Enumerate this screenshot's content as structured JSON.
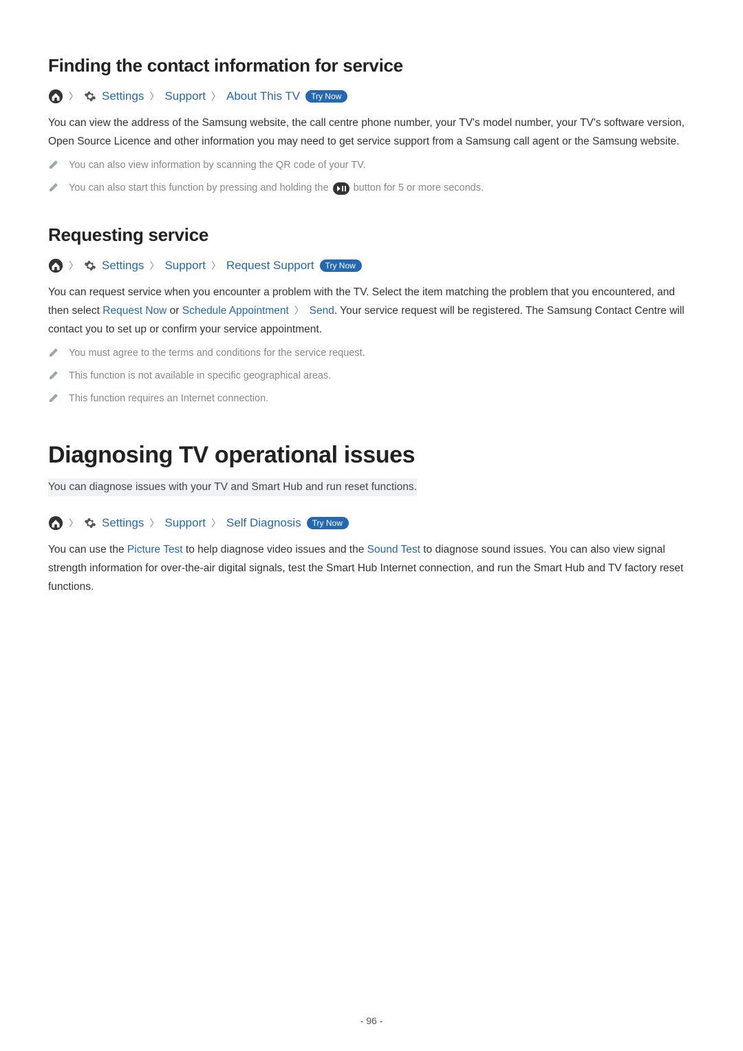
{
  "section1": {
    "heading": "Finding the contact information for service",
    "breadcrumb": {
      "settings": "Settings",
      "support": "Support",
      "leaf": "About This TV",
      "trynow": "Try Now"
    },
    "body": "You can view the address of the Samsung website, the call centre phone number, your TV's model number, your TV's software version, Open Source Licence and other information you may need to get service support from a Samsung call agent or the Samsung website.",
    "note1": "You can also view information by scanning the QR code of your TV.",
    "note2_a": "You can also start this function by pressing and holding the ",
    "note2_b": " button for 5 or more seconds."
  },
  "section2": {
    "heading": "Requesting service",
    "breadcrumb": {
      "settings": "Settings",
      "support": "Support",
      "leaf": "Request Support",
      "trynow": "Try Now"
    },
    "body_a": "You can request service when you encounter a problem with the TV. Select the item matching the problem that you encountered, and then select ",
    "link_request_now": "Request Now",
    "body_b": " or ",
    "link_schedule": "Schedule Appointment",
    "body_c": "Send",
    "body_d": ". Your service request will be registered. The Samsung Contact Centre will contact you to set up or confirm your service appointment.",
    "note1": "You must agree to the terms and conditions for the service request.",
    "note2": "This function is not available in specific geographical areas.",
    "note3": "This function requires an Internet connection."
  },
  "section3": {
    "heading": "Diagnosing TV operational issues",
    "subtitle": "You can diagnose issues with your TV and Smart Hub and run reset functions.",
    "breadcrumb": {
      "settings": "Settings",
      "support": "Support",
      "leaf": "Self Diagnosis",
      "trynow": "Try Now"
    },
    "body_a": "You can use the ",
    "link_picture": "Picture Test",
    "body_b": " to help diagnose video issues and the ",
    "link_sound": "Sound Test",
    "body_c": " to diagnose sound issues. You can also view signal strength information for over-the-air digital signals, test the Smart Hub Internet connection, and run the Smart Hub and TV factory reset functions."
  },
  "page_number": "- 96 -"
}
